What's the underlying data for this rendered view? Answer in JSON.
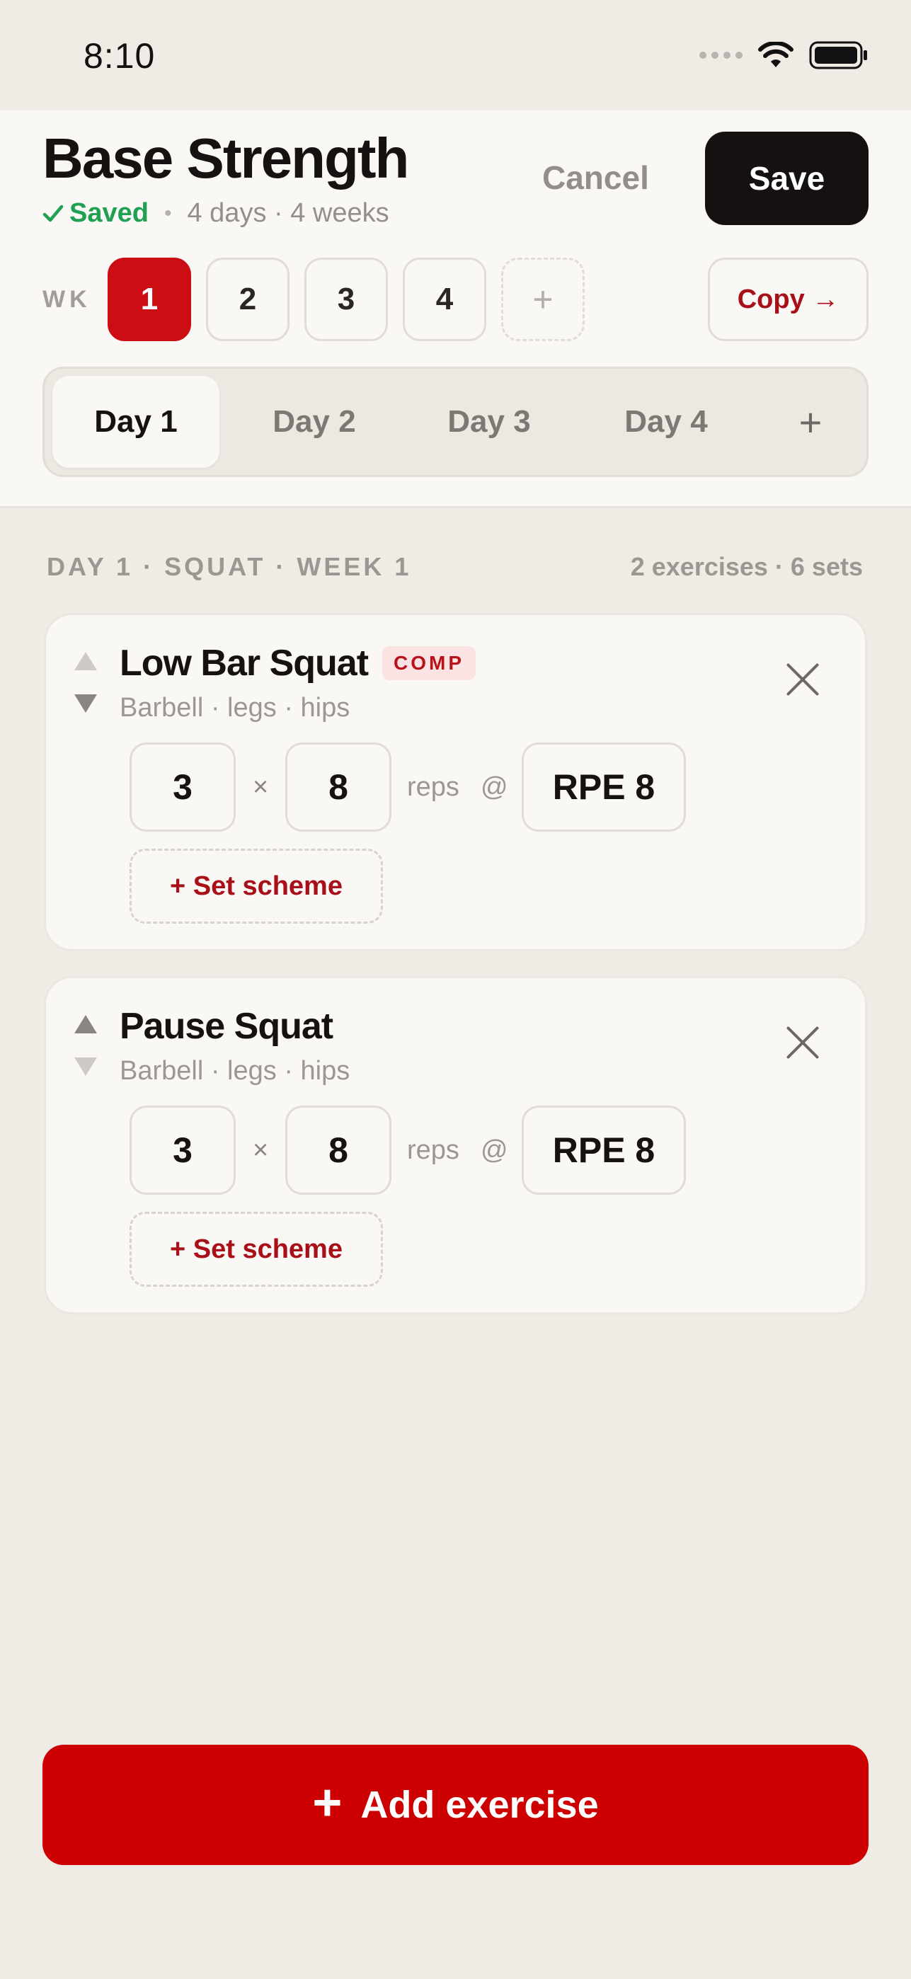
{
  "status_bar": {
    "time": "8:10"
  },
  "header": {
    "title": "Base Strength",
    "saved_label": "Saved",
    "details": "4 days · 4 weeks",
    "cancel_label": "Cancel",
    "save_label": "Save"
  },
  "weeks": {
    "label": "WK",
    "items": [
      "1",
      "2",
      "3",
      "4"
    ],
    "active": "1",
    "add_symbol": "+",
    "copy_label": "Copy →"
  },
  "days": {
    "tabs": [
      "Day 1",
      "Day 2",
      "Day 3",
      "Day 4"
    ],
    "active": "Day 1",
    "add_symbol": "+"
  },
  "section": {
    "heading": "DAY 1 · SQUAT · WEEK 1",
    "summary": "2 exercises · 6 sets"
  },
  "exercises": [
    {
      "name": "Low Bar Squat",
      "badge": "COMP",
      "meta": "Barbell · legs · hips",
      "sets": "3",
      "times": "×",
      "reps": "8",
      "reps_label": "reps",
      "at": "@",
      "intensity": "RPE 8",
      "scheme_label": "+ Set scheme"
    },
    {
      "name": "Pause Squat",
      "meta": "Barbell · legs · hips",
      "sets": "3",
      "times": "×",
      "reps": "8",
      "reps_label": "reps",
      "at": "@",
      "intensity": "RPE 8",
      "scheme_label": "+ Set scheme"
    }
  ],
  "footer": {
    "add_label": "Add exercise",
    "add_symbol": "+"
  },
  "colors": {
    "accent": "#cc0000",
    "saved": "#20a052",
    "background": "#f0ebe5",
    "surface": "#faf8f5",
    "primary_button": "#151110"
  }
}
